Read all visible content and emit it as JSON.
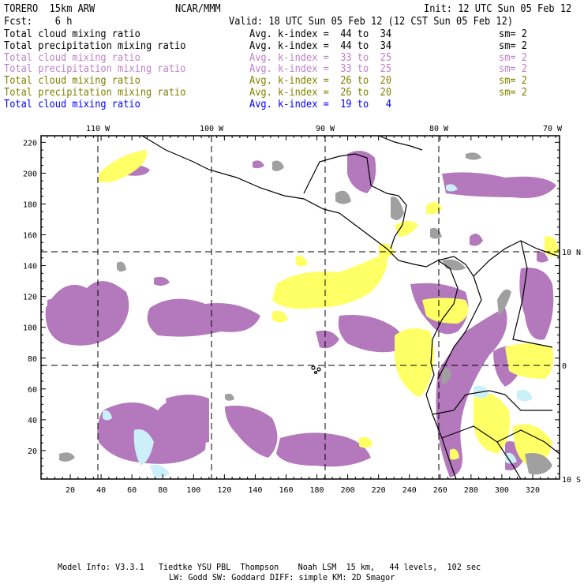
{
  "header": {
    "model": "TORERO  15km ARW",
    "org": "NCAR/MMM",
    "init": "Init: 12 UTC Sun 05 Feb 12",
    "fcst": "Fcst:    6 h",
    "valid": "Valid: 18 UTC Sun 05 Feb 12 (12 CST Sun 05 Feb 12)"
  },
  "legend": [
    {
      "field": "Total cloud mixing ratio",
      "range": "Avg. k-index =  44 to  34",
      "sm": "sm= 2",
      "color": "#000000"
    },
    {
      "field": "Total precipitation mixing ratio",
      "range": "Avg. k-index =  44 to  34",
      "sm": "sm= 2",
      "color": "#000000"
    },
    {
      "field": "Total cloud mixing ratio",
      "range": "Avg. k-index =  33 to  25",
      "sm": "sm= 2",
      "color": "#c080c8"
    },
    {
      "field": "Total precipitation mixing ratio",
      "range": "Avg. k-index =  33 to  25",
      "sm": "sm= 2",
      "color": "#c080c8"
    },
    {
      "field": "Total cloud mixing ratio",
      "range": "Avg. k-index =  26 to  20",
      "sm": "sm= 2",
      "color": "#808000"
    },
    {
      "field": "Total precipitation mixing ratio",
      "range": "Avg. k-index =  26 to  20",
      "sm": "sm= 2",
      "color": "#808000"
    },
    {
      "field": "Total cloud mixing ratio",
      "range": "Avg. k-index =  19 to   4",
      "sm": "",
      "color": "#0000ff"
    }
  ],
  "colors": {
    "purple": "#b478bc",
    "yellow": "#ffff66",
    "gray": "#a0a0a0",
    "lightblue": "#ccf0fa"
  },
  "map": {
    "x_ticks": [
      "20",
      "40",
      "60",
      "80",
      "100",
      "120",
      "140",
      "160",
      "180",
      "200",
      "220",
      "240",
      "260",
      "280",
      "300",
      "320"
    ],
    "y_ticks": [
      "20",
      "40",
      "60",
      "80",
      "100",
      "120",
      "140",
      "160",
      "180",
      "200",
      "220"
    ],
    "lon_labels": [
      "110 W",
      "100 W",
      "90 W",
      "80 W",
      "70 W"
    ],
    "lat_labels": [
      "10 N",
      "0",
      "10 S"
    ]
  },
  "footer": {
    "line1": "Model Info: V3.3.1   Tiedtke YSU PBL  Thompson    Noah LSM  15 km,   44 levels,  102 sec",
    "line2": "LW: Godd SW: Goddard DIFF: simple KM: 2D Smagor"
  }
}
